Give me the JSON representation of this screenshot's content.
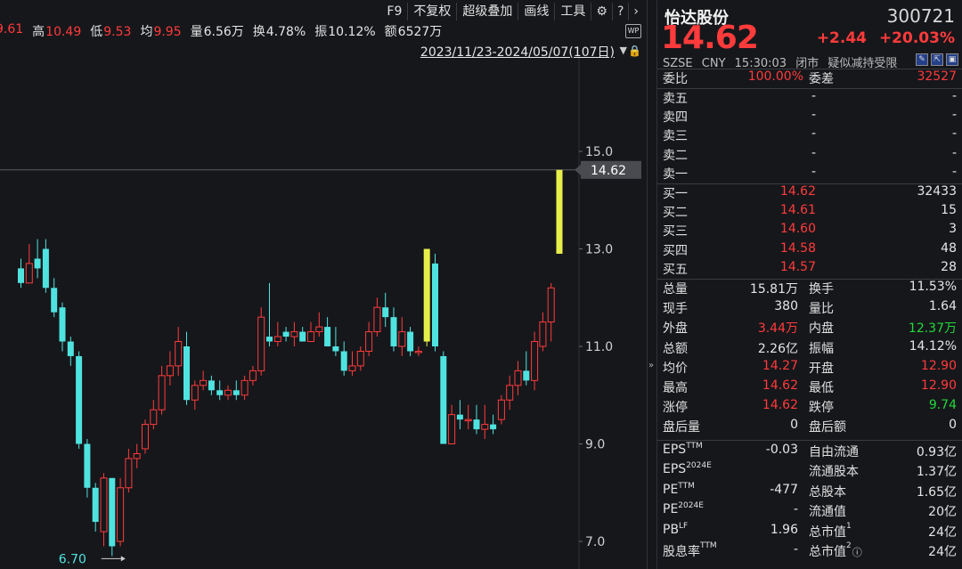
{
  "toolbar": {
    "items": [
      "F9",
      "不复权",
      "超级叠加",
      "画线",
      "工具"
    ],
    "icons": [
      "gear-icon",
      "help-icon",
      "chevron-right-icon"
    ]
  },
  "stats": [
    {
      "label": "",
      "value": "9.61",
      "color": "#ff3b3b"
    },
    {
      "label": "高",
      "value": "10.49",
      "color": "#ff3b3b"
    },
    {
      "label": "低",
      "value": "9.53",
      "color": "#ff3b3b"
    },
    {
      "label": "均",
      "value": "9.95",
      "color": "#ff3b3b"
    },
    {
      "label": "量",
      "value": "6.56万",
      "color": "#e6e6e6"
    },
    {
      "label": "换",
      "value": "4.78%",
      "color": "#e6e6e6"
    },
    {
      "label": "振",
      "value": "10.12%",
      "color": "#e6e6e6"
    },
    {
      "label": "额",
      "value": "6527万",
      "color": "#e6e6e6"
    }
  ],
  "date_range": "2023/11/23-2024/05/07(107日)",
  "wp_badge": "WP",
  "chart_data": {
    "type": "candlestick",
    "y_ticks": [
      "15.0",
      "13.0",
      "11.0",
      "9.0",
      "7.0"
    ],
    "y_tick_values": [
      15,
      13,
      11,
      9,
      7
    ],
    "current_price_label": "14.62",
    "current_price": 14.62,
    "low_marker_label": "6.70",
    "low_marker": 6.7,
    "colors": {
      "up": "#ff3b3b",
      "down": "#4fe3e0",
      "highlight": "#e6ee4a",
      "grid": "#2a2b30"
    },
    "candles": [
      {
        "o": 12.6,
        "h": 12.8,
        "l": 12.2,
        "c": 12.3
      },
      {
        "o": 12.3,
        "h": 13.1,
        "l": 12.3,
        "c": 12.7
      },
      {
        "o": 12.8,
        "h": 13.2,
        "l": 12.4,
        "c": 12.6
      },
      {
        "o": 13.0,
        "h": 13.2,
        "l": 12.1,
        "c": 12.2
      },
      {
        "o": 12.2,
        "h": 12.4,
        "l": 11.6,
        "c": 11.7
      },
      {
        "o": 11.8,
        "h": 11.9,
        "l": 10.9,
        "c": 11.1
      },
      {
        "o": 11.1,
        "h": 11.2,
        "l": 10.6,
        "c": 10.8
      },
      {
        "o": 10.8,
        "h": 10.9,
        "l": 8.9,
        "c": 9.0
      },
      {
        "o": 9.0,
        "h": 9.1,
        "l": 7.9,
        "c": 8.1
      },
      {
        "o": 8.1,
        "h": 8.2,
        "l": 7.2,
        "c": 7.4
      },
      {
        "o": 7.2,
        "h": 8.4,
        "l": 6.9,
        "c": 8.3
      },
      {
        "o": 8.3,
        "h": 8.3,
        "l": 6.7,
        "c": 6.9
      },
      {
        "o": 7.0,
        "h": 8.3,
        "l": 6.9,
        "c": 8.1
      },
      {
        "o": 8.1,
        "h": 8.9,
        "l": 8.0,
        "c": 8.7
      },
      {
        "o": 8.7,
        "h": 9.0,
        "l": 8.5,
        "c": 8.8
      },
      {
        "o": 8.9,
        "h": 9.5,
        "l": 8.8,
        "c": 9.4
      },
      {
        "o": 9.4,
        "h": 9.9,
        "l": 9.3,
        "c": 9.7
      },
      {
        "o": 9.7,
        "h": 10.6,
        "l": 9.6,
        "c": 10.4
      },
      {
        "o": 10.4,
        "h": 10.9,
        "l": 10.2,
        "c": 10.6
      },
      {
        "o": 10.6,
        "h": 11.4,
        "l": 10.4,
        "c": 11.1
      },
      {
        "o": 11.0,
        "h": 11.3,
        "l": 9.8,
        "c": 9.9
      },
      {
        "o": 9.9,
        "h": 10.3,
        "l": 9.7,
        "c": 10.2
      },
      {
        "o": 10.2,
        "h": 10.5,
        "l": 10.1,
        "c": 10.3
      },
      {
        "o": 10.3,
        "h": 10.4,
        "l": 10.0,
        "c": 10.1
      },
      {
        "o": 10.1,
        "h": 10.3,
        "l": 9.9,
        "c": 10.0
      },
      {
        "o": 10.0,
        "h": 10.2,
        "l": 9.9,
        "c": 10.1
      },
      {
        "o": 10.1,
        "h": 10.3,
        "l": 9.9,
        "c": 10.0
      },
      {
        "o": 10.0,
        "h": 10.4,
        "l": 9.9,
        "c": 10.3
      },
      {
        "o": 10.3,
        "h": 10.6,
        "l": 10.2,
        "c": 10.5
      },
      {
        "o": 10.5,
        "h": 11.8,
        "l": 10.4,
        "c": 11.6
      },
      {
        "o": 11.2,
        "h": 12.3,
        "l": 11.0,
        "c": 11.1
      },
      {
        "o": 11.1,
        "h": 11.5,
        "l": 11.0,
        "c": 11.2
      },
      {
        "o": 11.3,
        "h": 11.4,
        "l": 11.1,
        "c": 11.2
      },
      {
        "o": 11.2,
        "h": 11.5,
        "l": 11.0,
        "c": 11.3
      },
      {
        "o": 11.3,
        "h": 11.4,
        "l": 11.1,
        "c": 11.1
      },
      {
        "o": 11.1,
        "h": 11.5,
        "l": 11.1,
        "c": 11.3
      },
      {
        "o": 11.3,
        "h": 11.7,
        "l": 11.2,
        "c": 11.4
      },
      {
        "o": 11.4,
        "h": 11.6,
        "l": 11.0,
        "c": 11.0
      },
      {
        "o": 11.0,
        "h": 11.4,
        "l": 10.8,
        "c": 10.9
      },
      {
        "o": 10.9,
        "h": 11.1,
        "l": 10.4,
        "c": 10.5
      },
      {
        "o": 10.5,
        "h": 10.9,
        "l": 10.4,
        "c": 10.6
      },
      {
        "o": 10.6,
        "h": 11.0,
        "l": 10.5,
        "c": 10.9
      },
      {
        "o": 10.9,
        "h": 11.5,
        "l": 10.8,
        "c": 11.3
      },
      {
        "o": 11.3,
        "h": 12.0,
        "l": 11.2,
        "c": 11.8
      },
      {
        "o": 11.8,
        "h": 12.1,
        "l": 11.4,
        "c": 11.6
      },
      {
        "o": 11.6,
        "h": 11.8,
        "l": 10.9,
        "c": 11.0
      },
      {
        "o": 11.0,
        "h": 11.6,
        "l": 10.8,
        "c": 11.3
      },
      {
        "o": 11.3,
        "h": 11.4,
        "l": 10.8,
        "c": 10.9
      },
      {
        "o": 10.9,
        "h": 11.0,
        "l": 10.8,
        "c": 10.9
      },
      {
        "o": 11.1,
        "h": 13.0,
        "l": 11.0,
        "c": 13.0,
        "hl": true
      },
      {
        "o": 12.7,
        "h": 12.9,
        "l": 10.9,
        "c": 11.0
      },
      {
        "o": 10.8,
        "h": 10.9,
        "l": 9.0,
        "c": 9.0
      },
      {
        "o": 9.0,
        "h": 9.8,
        "l": 9.0,
        "c": 9.6
      },
      {
        "o": 9.6,
        "h": 9.9,
        "l": 9.3,
        "c": 9.5
      },
      {
        "o": 9.5,
        "h": 9.8,
        "l": 9.3,
        "c": 9.5
      },
      {
        "o": 9.5,
        "h": 9.8,
        "l": 9.2,
        "c": 9.3
      },
      {
        "o": 9.3,
        "h": 9.8,
        "l": 9.1,
        "c": 9.4
      },
      {
        "o": 9.4,
        "h": 9.6,
        "l": 9.2,
        "c": 9.3
      },
      {
        "o": 9.5,
        "h": 10.0,
        "l": 9.4,
        "c": 9.9
      },
      {
        "o": 9.9,
        "h": 10.4,
        "l": 9.7,
        "c": 10.2
      },
      {
        "o": 10.2,
        "h": 10.7,
        "l": 10.0,
        "c": 10.5
      },
      {
        "o": 10.5,
        "h": 10.9,
        "l": 10.2,
        "c": 10.3
      },
      {
        "o": 10.3,
        "h": 11.3,
        "l": 10.1,
        "c": 11.1
      },
      {
        "o": 11.0,
        "h": 11.7,
        "l": 10.9,
        "c": 11.5
      },
      {
        "o": 11.5,
        "h": 12.3,
        "l": 11.1,
        "c": 12.2
      },
      {
        "o": 12.9,
        "h": 14.62,
        "l": 12.9,
        "c": 14.62,
        "hl": true
      }
    ]
  },
  "quote": {
    "name": "怡达股份",
    "code": "300721",
    "price": "14.62",
    "change": "+2.44",
    "change_pct": "+20.03%",
    "exchange": "SZSE",
    "currency": "CNY",
    "time": "15:30:03",
    "status": "闭市",
    "note": "疑似减持受限",
    "icons": [
      "edit-icon",
      "popout-icon",
      "settings-icon"
    ],
    "commission": {
      "ratio_label": "委比",
      "ratio": "100.00%",
      "diff_label": "委差",
      "diff": "32527"
    },
    "asks": [
      {
        "label": "卖五",
        "price": "-",
        "vol": "-"
      },
      {
        "label": "卖四",
        "price": "-",
        "vol": "-"
      },
      {
        "label": "卖三",
        "price": "-",
        "vol": "-"
      },
      {
        "label": "卖二",
        "price": "-",
        "vol": "-"
      },
      {
        "label": "卖一",
        "price": "-",
        "vol": "-"
      }
    ],
    "bids": [
      {
        "label": "买一",
        "price": "14.62",
        "vol": "32433"
      },
      {
        "label": "买二",
        "price": "14.61",
        "vol": "15"
      },
      {
        "label": "买三",
        "price": "14.60",
        "vol": "3"
      },
      {
        "label": "买四",
        "price": "14.58",
        "vol": "48"
      },
      {
        "label": "买五",
        "price": "14.57",
        "vol": "28"
      }
    ],
    "details": [
      {
        "l1": "总量",
        "v1": "15.81万",
        "c1": "white",
        "l2": "换手",
        "v2": "11.53%",
        "c2": "white"
      },
      {
        "l1": "现手",
        "v1": "380",
        "c1": "white",
        "l2": "量比",
        "v2": "1.64",
        "c2": "white"
      },
      {
        "l1": "外盘",
        "v1": "3.44万",
        "c1": "red",
        "l2": "内盘",
        "v2": "12.37万",
        "c2": "green"
      },
      {
        "l1": "总额",
        "v1": "2.26亿",
        "c1": "white",
        "l2": "振幅",
        "v2": "14.12%",
        "c2": "white"
      },
      {
        "l1": "均价",
        "v1": "14.27",
        "c1": "red",
        "l2": "开盘",
        "v2": "12.90",
        "c2": "red"
      },
      {
        "l1": "最高",
        "v1": "14.62",
        "c1": "red",
        "l2": "最低",
        "v2": "12.90",
        "c2": "red"
      },
      {
        "l1": "涨停",
        "v1": "14.62",
        "c1": "red",
        "l2": "跌停",
        "v2": "9.74",
        "c2": "green"
      },
      {
        "l1": "盘后量",
        "v1": "0",
        "c1": "white",
        "l2": "盘后额",
        "v2": "0",
        "c2": "white"
      }
    ],
    "fundamentals": [
      {
        "l1": "EPS",
        "s1": "TTM",
        "v1": "-0.03",
        "l2": "自由流通",
        "s2": "",
        "v2": "0.93亿"
      },
      {
        "l1": "EPS",
        "s1": "2024E",
        "v1": "",
        "l2": "流通股本",
        "s2": "",
        "v2": "1.37亿"
      },
      {
        "l1": "PE",
        "s1": "TTM",
        "v1": "-477",
        "l2": "总股本",
        "s2": "",
        "v2": "1.65亿"
      },
      {
        "l1": "PE",
        "s1": "2024E",
        "v1": "-",
        "l2": "流通值",
        "s2": "",
        "v2": "20亿"
      },
      {
        "l1": "PB",
        "s1": "LF",
        "v1": "1.96",
        "l2": "总市值",
        "s2": "1",
        "v2": "24亿"
      },
      {
        "l1": "股息率",
        "s1": "TTM",
        "v1": "-",
        "l2": "总市值",
        "s2": "2",
        "v2": "24亿"
      }
    ]
  }
}
